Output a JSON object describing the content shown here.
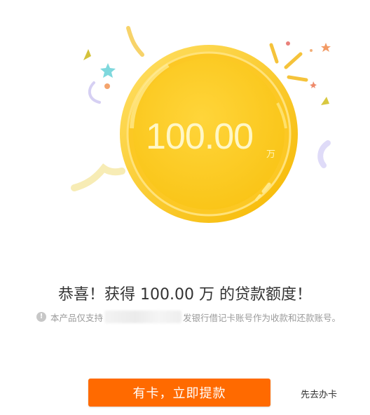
{
  "coin": {
    "amount": "100.00",
    "unit": "万"
  },
  "headline": "恭喜！获得  100.00 万 的贷款额度！",
  "notice": {
    "icon": "info-icon",
    "text_before": "本产品仅支持",
    "text_after": "发银行借记卡账号作为收款和还款账号。"
  },
  "actions": {
    "primary_label": "有卡，立即提款",
    "secondary_label": "先去办卡"
  },
  "colors": {
    "primary": "#ff6a00",
    "coin": "#fbc51f",
    "coin_light": "#ffd84a"
  }
}
